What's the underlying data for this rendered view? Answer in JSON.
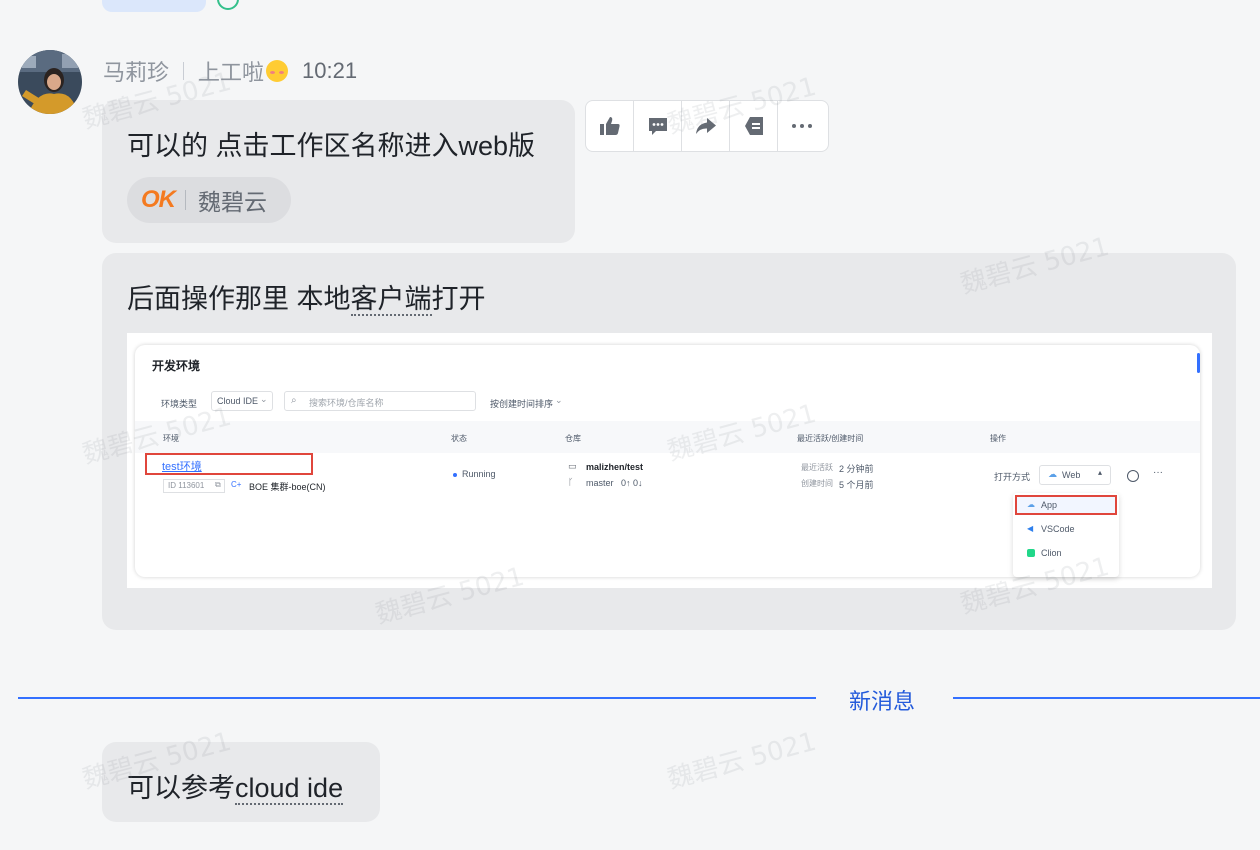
{
  "sender": {
    "name": "马莉珍",
    "status": "上工啦",
    "time": "10:21"
  },
  "messages": [
    {
      "text": "可以的 点击工作区名称进入web版"
    },
    {
      "text_before": "后面操作那里 本地",
      "text_underlined": "客户端",
      "text_after": "打开"
    },
    {
      "text_before": "可以参考",
      "text_underlined": "cloud ide"
    }
  ],
  "reaction": {
    "emoji": "OK",
    "user": "魏碧云"
  },
  "toolbar": {
    "icons": [
      "thumbs-up-icon",
      "comment-icon",
      "forward-icon",
      "pin-icon",
      "more-icon"
    ],
    "more_label": "···"
  },
  "divider": {
    "label": "新消息"
  },
  "watermark": {
    "text": "魏碧云 5021"
  },
  "embedded_screenshot": {
    "title": "开发环境",
    "filter_type_label": "环境类型",
    "filter_type_value": "Cloud IDE",
    "search_placeholder": "搜索环境/仓库名称",
    "sort_label": "按创建时间排序",
    "columns": [
      "环境",
      "状态",
      "仓库",
      "最近活跃/创建时间",
      "操作"
    ],
    "row": {
      "env_name": "test环境",
      "env_id": "ID 113601",
      "cluster": "BOE 集群-boe(CN)",
      "status": "Running",
      "repo": "malizhen/test",
      "branch": "master",
      "branch_counts": "0↑ 0↓",
      "last_active_label": "最近活跃",
      "last_active": "2 分钟前",
      "created_label": "创建时间",
      "created": "5 个月前",
      "open_label": "打开方式",
      "open_value": "Web"
    },
    "dropdown": [
      "App",
      "VSCode",
      "Clion"
    ]
  },
  "colors": {
    "accent": "#3370ff",
    "bubble": "#e8e9eb",
    "highlight": "#e0463c"
  }
}
